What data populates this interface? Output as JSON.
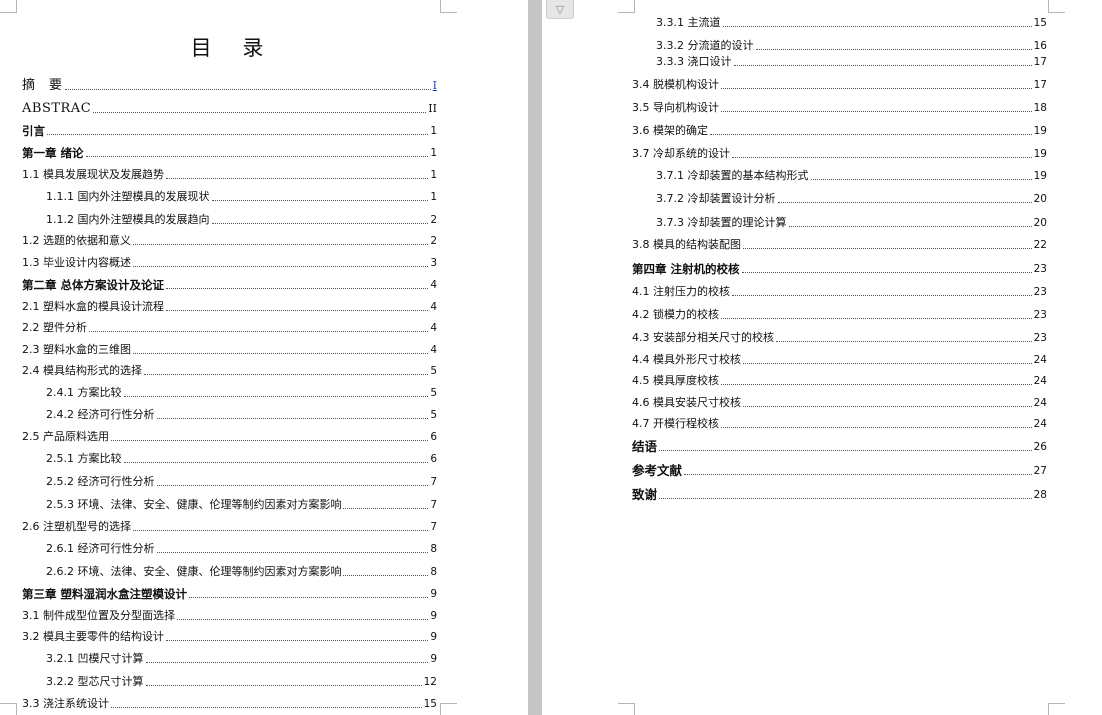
{
  "left_page": {
    "title": "目 录",
    "entries": [
      {
        "text": "摘　要",
        "page": "I",
        "level": "front",
        "link": true
      },
      {
        "text": "ABSTRAC",
        "page": "II",
        "level": "front"
      },
      {
        "text": "引言",
        "page": "1",
        "level": "chapter"
      },
      {
        "text": "第一章  绪论",
        "page": "1",
        "level": "chapter"
      },
      {
        "text": "1.1 模具发展现状及发展趋势",
        "page": "1",
        "level": "section"
      },
      {
        "text": "1.1.1 国内外注塑模具的发展现状",
        "page": "1",
        "level": "sub"
      },
      {
        "text": "1.1.2 国内外注塑模具的发展趋向",
        "page": "2",
        "level": "sub"
      },
      {
        "text": "1.2 选题的依据和意义",
        "page": "2",
        "level": "section"
      },
      {
        "text": "1.3 毕业设计内容概述",
        "page": "3",
        "level": "section"
      },
      {
        "text": "第二章  总体方案设计及论证",
        "page": "4",
        "level": "chapter"
      },
      {
        "text": "2.1 塑料水盒的模具设计流程",
        "page": "4",
        "level": "section"
      },
      {
        "text": "2.2 塑件分析",
        "page": "4",
        "level": "section"
      },
      {
        "text": "2.3 塑料水盒的三维图",
        "page": "4",
        "level": "section"
      },
      {
        "text": "2.4 模具结构形式的选择",
        "page": "5",
        "level": "section"
      },
      {
        "text": "2.4.1 方案比较",
        "page": "5",
        "level": "sub"
      },
      {
        "text": "2.4.2 经济可行性分析",
        "page": "5",
        "level": "sub"
      },
      {
        "text": "2.5 产品原料选用",
        "page": "6",
        "level": "section"
      },
      {
        "text": "2.5.1 方案比较",
        "page": "6",
        "level": "sub"
      },
      {
        "text": "2.5.2 经济可行性分析",
        "page": "7",
        "level": "sub"
      },
      {
        "text": "2.5.3 环境、法律、安全、健康、伦理等制约因素对方案影响",
        "page": "7",
        "level": "sub"
      },
      {
        "text": "2.6 注塑机型号的选择",
        "page": "7",
        "level": "section"
      },
      {
        "text": "2.6.1 经济可行性分析",
        "page": "8",
        "level": "sub"
      },
      {
        "text": "2.6.2 环境、法律、安全、健康、伦理等制约因素对方案影响",
        "page": "8",
        "level": "sub"
      },
      {
        "text": "第三章   塑料湿润水盒注塑模设计",
        "page": "9",
        "level": "chapter"
      },
      {
        "text": "3.1 制件成型位置及分型面选择",
        "page": "9",
        "level": "section"
      },
      {
        "text": "3.2 模具主要零件的结构设计",
        "page": "9",
        "level": "section"
      },
      {
        "text": "3.2.1 凹模尺寸计算",
        "page": "9",
        "level": "sub"
      },
      {
        "text": "3.2.2 型芯尺寸计算",
        "page": "12",
        "level": "sub"
      },
      {
        "text": "3.3 浇注系统设计",
        "page": "15",
        "level": "section"
      }
    ]
  },
  "right_page": {
    "entries": [
      {
        "text": "3.3.1 主流道",
        "page": "15",
        "level": "sub"
      },
      {
        "text": "3.3.2 分流道的设计",
        "page": "16",
        "level": "sub"
      },
      {
        "text": "3.3.3 浇口设计",
        "page": "17",
        "level": "sub"
      },
      {
        "text": "3.4 脱模机构设计",
        "page": "17",
        "level": "section"
      },
      {
        "text": "3.5 导向机构设计",
        "page": "18",
        "level": "section"
      },
      {
        "text": "3.6 模架的确定",
        "page": "19",
        "level": "section"
      },
      {
        "text": "3.7 冷却系统的设计",
        "page": "19",
        "level": "section"
      },
      {
        "text": "3.7.1 冷却装置的基本结构形式",
        "page": "19",
        "level": "sub"
      },
      {
        "text": "3.7.2 冷却装置设计分析",
        "page": "20",
        "level": "sub"
      },
      {
        "text": "3.7.3 冷却装置的理论计算",
        "page": "20",
        "level": "sub"
      },
      {
        "text": "3.8 模具的结构装配图",
        "page": "22",
        "level": "section"
      },
      {
        "text": "第四章  注射机的校核",
        "page": "23",
        "level": "chapter"
      },
      {
        "text": "4.1 注射压力的校核",
        "page": "23",
        "level": "section"
      },
      {
        "text": "4.2 锁模力的校核",
        "page": "23",
        "level": "section"
      },
      {
        "text": "4.3 安装部分相关尺寸的校核",
        "page": "23",
        "level": "section"
      },
      {
        "text": "4.4 模具外形尺寸校核",
        "page": "24",
        "level": "section"
      },
      {
        "text": "4.5 模具厚度校核",
        "page": "24",
        "level": "section"
      },
      {
        "text": "4.6 模具安装尺寸校核",
        "page": "24",
        "level": "section"
      },
      {
        "text": "4.7 开模行程校核",
        "page": "24",
        "level": "section"
      },
      {
        "text": "结语",
        "page": "26",
        "level": "back"
      },
      {
        "text": "参考文献",
        "page": "27",
        "level": "back"
      },
      {
        "text": "致谢",
        "page": "28",
        "level": "back"
      }
    ]
  }
}
